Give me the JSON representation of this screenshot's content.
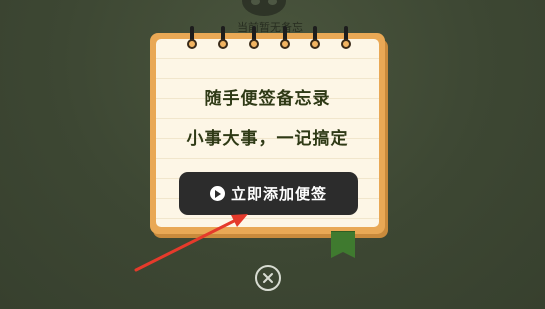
{
  "background": {
    "empty_state_text": "当前暂无备忘"
  },
  "popup": {
    "title": "随手便签备忘录",
    "subtitle": "小事大事，一记搞定",
    "cta_label": "立即添加便签",
    "cta_icon": "play-circle-icon",
    "close_icon": "close-circle-icon"
  },
  "colors": {
    "overlay": "#3f4a34",
    "card_frame": "#e9a855",
    "paper": "#fdf6e6",
    "text": "#2f3a16",
    "button": "#2c2c2c",
    "bookmark": "#3f7a2f",
    "annotation_arrow": "#e53a2b"
  }
}
